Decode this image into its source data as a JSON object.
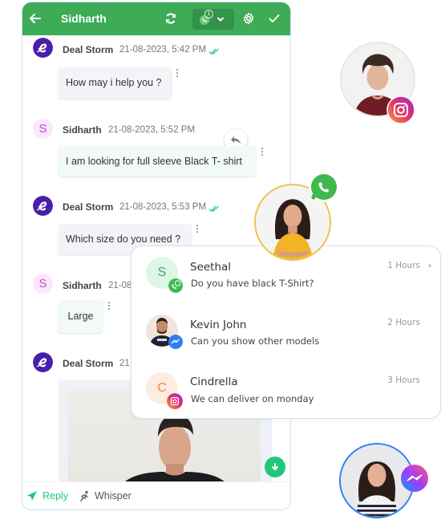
{
  "chat": {
    "header": {
      "title": "Sidharth",
      "channel_badge_count": "1",
      "color": "#3eab56"
    },
    "messages": [
      {
        "sender": "Deal Storm",
        "avatar_letter": "",
        "time": "21-08-2023, 5:42 PM",
        "text": "How may i help you ?",
        "direction": "outgoing",
        "status": "read"
      },
      {
        "sender": "Sidharth",
        "avatar_letter": "S",
        "time": "21-08-2023, 5:52 PM",
        "text": "I am looking for full sleeve Black T- shirt",
        "direction": "incoming"
      },
      {
        "sender": "Deal Storm",
        "avatar_letter": "",
        "time": "21-08-2023, 5:53 PM",
        "text": "Which size do you need ?",
        "direction": "outgoing",
        "status": "read"
      },
      {
        "sender": "Sidharth",
        "avatar_letter": "S",
        "time": "21-08",
        "text": "Large",
        "direction": "incoming"
      },
      {
        "sender": "Deal Storm",
        "avatar_letter": "",
        "time": "21",
        "text": "",
        "direction": "outgoing",
        "attachment": "image"
      }
    ],
    "footer": {
      "reply_label": "Reply",
      "whisper_label": "Whisper"
    }
  },
  "inbox": {
    "items": [
      {
        "name": "Seethal",
        "avatar_letter": "S",
        "message": "Do you have black T-Shirt?",
        "time": "1 Hours",
        "channel": "whatsapp"
      },
      {
        "name": "Kevin John",
        "avatar_letter": "",
        "message": "Can you show other models",
        "time": "2 Hours",
        "channel": "messenger"
      },
      {
        "name": "Cindrella",
        "avatar_letter": "C",
        "message": "We can deliver on monday",
        "time": "3 Hours",
        "channel": "instagram"
      }
    ]
  },
  "floating_contacts": [
    {
      "channel": "instagram"
    },
    {
      "channel": "whatsapp"
    },
    {
      "channel": "messenger"
    }
  ],
  "colors": {
    "brand_green": "#3eab56",
    "deal_storm_purple": "#4a1fa8",
    "read_tick": "#22c98a",
    "scroll_fab": "#20c77d",
    "whatsapp": "#3fb94e",
    "messenger": "#2f7cf6",
    "instagram_start": "#f9a53b",
    "instagram_end": "#b62ac6"
  }
}
